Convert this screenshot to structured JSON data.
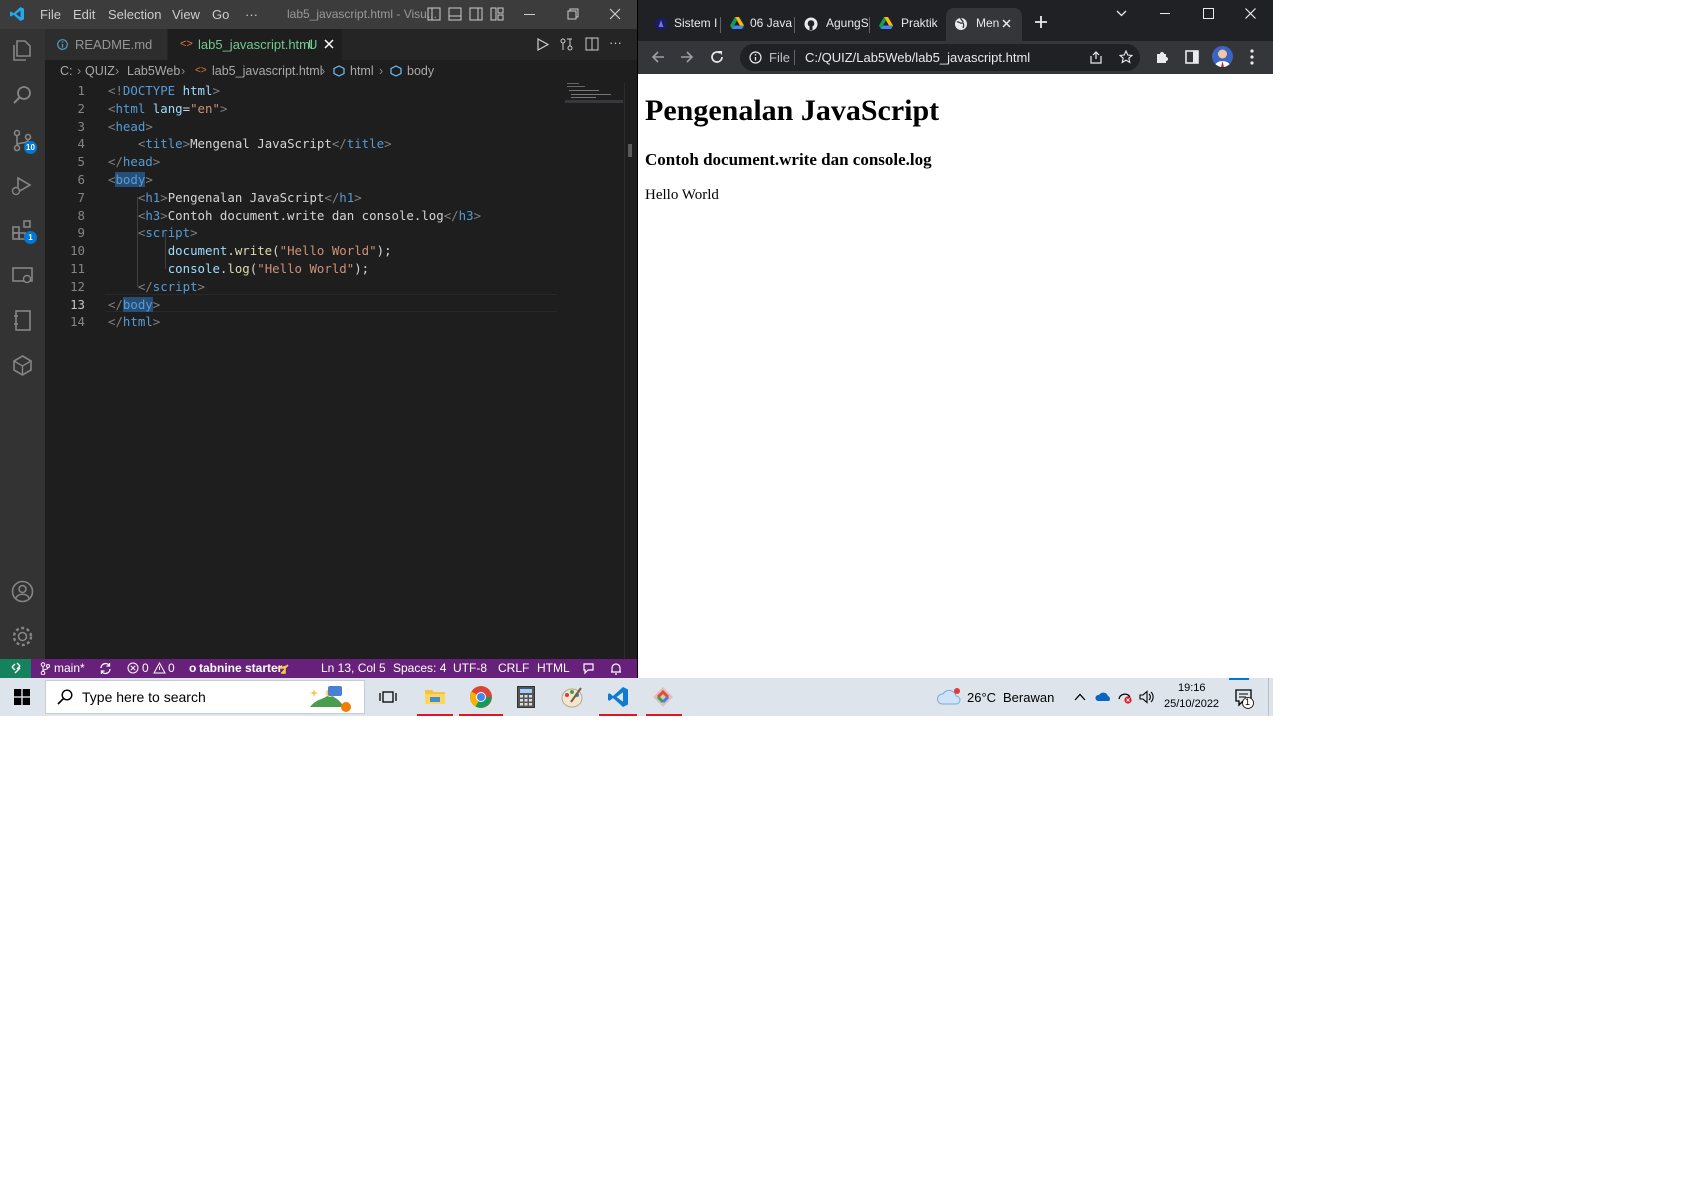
{
  "vscode": {
    "window_title": "lab5_javascript.html - Visu...",
    "menu": [
      "File",
      "Edit",
      "Selection",
      "View",
      "Go",
      "···"
    ],
    "activity": {
      "scm_badge": "10",
      "extensions_badge": "1"
    },
    "tabs": [
      {
        "label": "README.md",
        "icon": "info-icon"
      },
      {
        "label": "lab5_javascript.html",
        "status": "U",
        "icon": "html-icon"
      }
    ],
    "breadcrumb": [
      "C:",
      "QUIZ",
      "Lab5Web",
      "lab5_javascript.html",
      "html",
      "body"
    ],
    "code": [
      {
        "n": "1",
        "parts": [
          [
            "tg",
            "<!"
          ],
          [
            "tn",
            "DOCTYPE"
          ],
          [
            "tx",
            " "
          ],
          [
            "at",
            "html"
          ],
          [
            "tg",
            ">"
          ]
        ]
      },
      {
        "n": "2",
        "parts": [
          [
            "tg",
            "<"
          ],
          [
            "tn",
            "html"
          ],
          [
            "tx",
            " "
          ],
          [
            "at",
            "lang"
          ],
          [
            "tx",
            "="
          ],
          [
            "st",
            "\"en\""
          ],
          [
            "tg",
            ">"
          ]
        ]
      },
      {
        "n": "3",
        "parts": [
          [
            "tg",
            "<"
          ],
          [
            "tn",
            "head"
          ],
          [
            "tg",
            ">"
          ]
        ]
      },
      {
        "n": "4",
        "parts": [
          [
            "tx",
            "    "
          ],
          [
            "tg",
            "<"
          ],
          [
            "tn",
            "title"
          ],
          [
            "tg",
            ">"
          ],
          [
            "tx",
            "Mengenal JavaScript"
          ],
          [
            "tg",
            "</"
          ],
          [
            "tn",
            "title"
          ],
          [
            "tg",
            ">"
          ]
        ]
      },
      {
        "n": "5",
        "parts": [
          [
            "tg",
            "</"
          ],
          [
            "tn",
            "head"
          ],
          [
            "tg",
            ">"
          ]
        ]
      },
      {
        "n": "6",
        "parts": [
          [
            "tg",
            "<"
          ],
          [
            "tn",
            "body"
          ],
          [
            "tg",
            ">"
          ]
        ]
      },
      {
        "n": "7",
        "parts": [
          [
            "tx",
            "    "
          ],
          [
            "tg",
            "<"
          ],
          [
            "tn",
            "h1"
          ],
          [
            "tg",
            ">"
          ],
          [
            "tx",
            "Pengenalan JavaScript"
          ],
          [
            "tg",
            "</"
          ],
          [
            "tn",
            "h1"
          ],
          [
            "tg",
            ">"
          ]
        ]
      },
      {
        "n": "8",
        "parts": [
          [
            "tx",
            "    "
          ],
          [
            "tg",
            "<"
          ],
          [
            "tn",
            "h3"
          ],
          [
            "tg",
            ">"
          ],
          [
            "tx",
            "Contoh document.write dan console.log"
          ],
          [
            "tg",
            "</"
          ],
          [
            "tn",
            "h3"
          ],
          [
            "tg",
            ">"
          ]
        ]
      },
      {
        "n": "9",
        "parts": [
          [
            "tx",
            "    "
          ],
          [
            "tg",
            "<"
          ],
          [
            "tn",
            "script"
          ],
          [
            "tg",
            ">"
          ]
        ]
      },
      {
        "n": "10",
        "parts": [
          [
            "tx",
            "        "
          ],
          [
            "vr",
            "document"
          ],
          [
            "tx",
            "."
          ],
          [
            "fn",
            "write"
          ],
          [
            "tx",
            "("
          ],
          [
            "st",
            "\"Hello World\""
          ],
          [
            "tx",
            ");"
          ]
        ]
      },
      {
        "n": "11",
        "parts": [
          [
            "tx",
            "        "
          ],
          [
            "vr",
            "console"
          ],
          [
            "tx",
            "."
          ],
          [
            "fn",
            "log"
          ],
          [
            "tx",
            "("
          ],
          [
            "st",
            "\"Hello World\""
          ],
          [
            "tx",
            ");"
          ]
        ]
      },
      {
        "n": "12",
        "parts": [
          [
            "tx",
            "    "
          ],
          [
            "tg",
            "</"
          ],
          [
            "tn",
            "script"
          ],
          [
            "tg",
            ">"
          ]
        ]
      },
      {
        "n": "13",
        "parts": [
          [
            "tg",
            "</"
          ],
          [
            "tn",
            "body"
          ],
          [
            "tg",
            ">"
          ]
        ]
      },
      {
        "n": "14",
        "parts": [
          [
            "tg",
            "</"
          ],
          [
            "tn",
            "html"
          ],
          [
            "tg",
            ">"
          ]
        ]
      }
    ],
    "current_line": "13",
    "status": {
      "branch": "main*",
      "errors": "0",
      "warnings": "0",
      "tabnine": "tabnine starter",
      "position": "Ln 13, Col 5",
      "spaces": "Spaces: 4",
      "encoding": "UTF-8",
      "eol": "CRLF",
      "language": "HTML"
    },
    "colors": {
      "status_bar": "#68217a",
      "remote": "#16825d",
      "accent": "#0078d4"
    }
  },
  "chrome": {
    "tabs": [
      {
        "label": "Sistem I",
        "icon": "site-icon"
      },
      {
        "label": "06 Java",
        "icon": "drive-icon"
      },
      {
        "label": "AgungS",
        "icon": "github-icon"
      },
      {
        "label": "Praktik",
        "icon": "drive-icon"
      },
      {
        "label": "Men",
        "icon": "globe-icon",
        "active": true
      }
    ],
    "omnibox": {
      "scheme": "File",
      "url": "C:/QUIZ/Lab5Web/lab5_javascript.html"
    },
    "page": {
      "h1": "Pengenalan JavaScript",
      "h3": "Contoh document.write dan console.log",
      "text": "Hello World"
    }
  },
  "taskbar": {
    "search_placeholder": "Type here to search",
    "apps": [
      "task-view",
      "file-explorer",
      "chrome",
      "calculator",
      "paint",
      "vscode",
      "git"
    ],
    "weather": {
      "temp": "26°C",
      "desc": "Berawan"
    },
    "time": "19:16",
    "date": "25/10/2022",
    "notifications": "1"
  }
}
